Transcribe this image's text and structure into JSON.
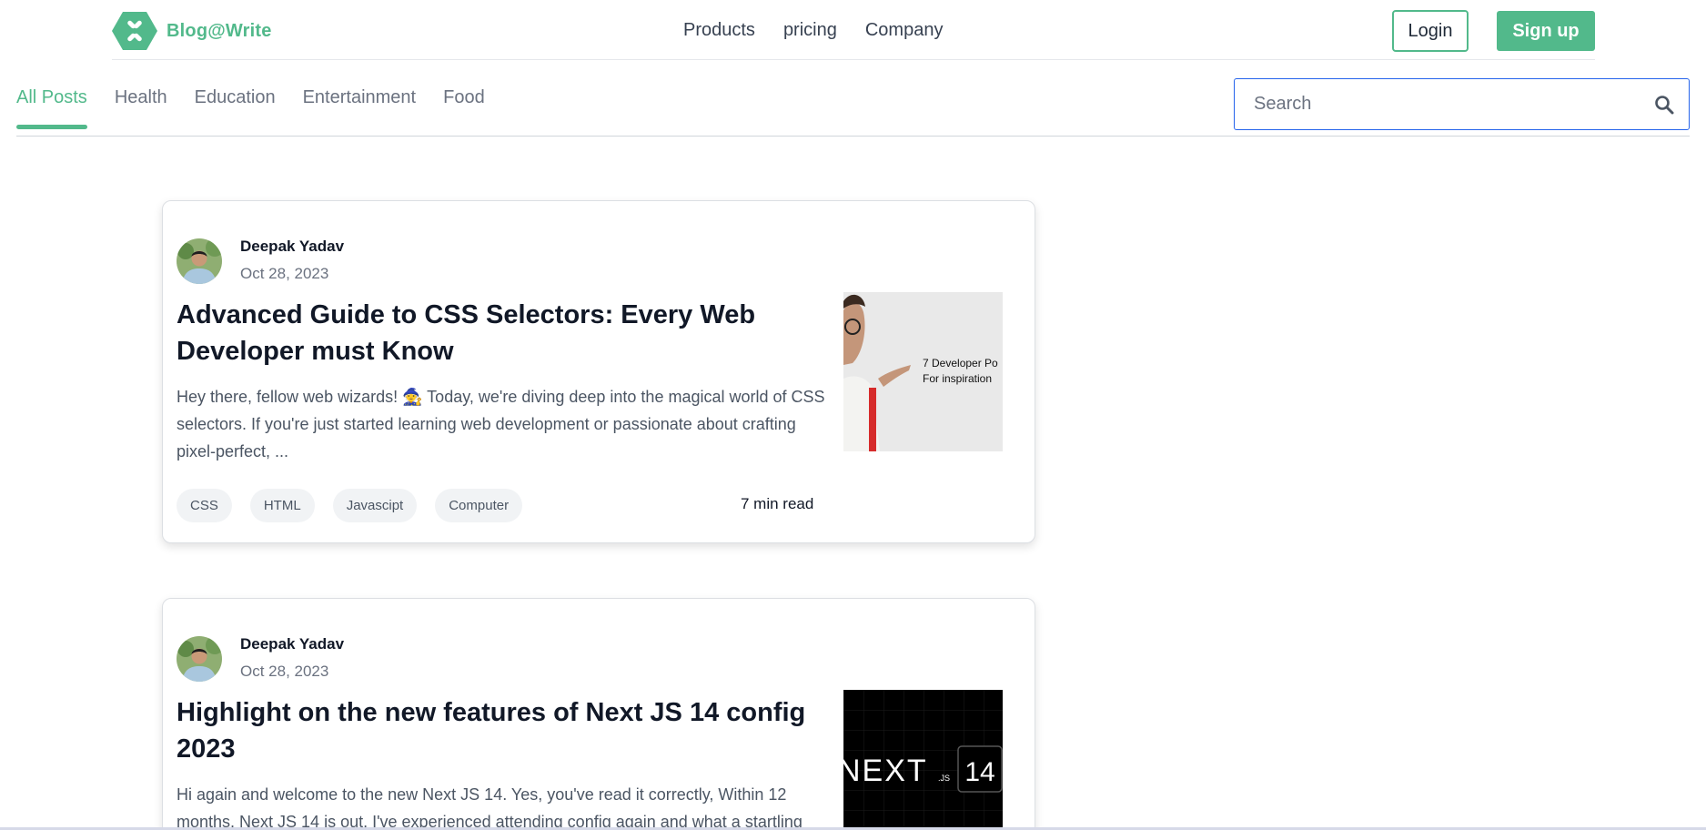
{
  "brand": {
    "name": "Blog@Write",
    "color": "#52b98b"
  },
  "topnav": {
    "items": [
      "Products",
      "pricing",
      "Company"
    ]
  },
  "auth": {
    "login": "Login",
    "signup": "Sign up"
  },
  "categories": {
    "active": "All Posts",
    "items": [
      "All Posts",
      "Health",
      "Education",
      "Entertainment",
      "Food"
    ]
  },
  "search": {
    "placeholder": "Search",
    "value": "",
    "icon": "search-icon"
  },
  "posts": [
    {
      "author": "Deepak Yadav",
      "date": "Oct 28, 2023",
      "title": "Advanced Guide to CSS Selectors: Every Web Developer must Know",
      "excerpt": "Hey there, fellow web wizards! 🧙 Today, we're diving deep into the magical world of CSS selectors. If you're just started learning web development or passionate about crafting pixel-perfect, ...",
      "tags": [
        "CSS",
        "HTML",
        "Javascipt",
        "Computer"
      ],
      "read_time": "7 min read",
      "thumbnail_text": [
        "7 Developer Po",
        "For inspiration"
      ]
    },
    {
      "author": "Deepak Yadav",
      "date": "Oct 28, 2023",
      "title": "Highlight on the new features of Next JS 14 config 2023",
      "excerpt": "Hi again and welcome to the new Next JS 14. Yes, you've read it correctly, Within 12 months, Next JS 14 is out. I've experienced attending config again and what a startling presentation",
      "thumbnail_text": [
        "NEXT",
        ".JS",
        "14"
      ]
    }
  ]
}
